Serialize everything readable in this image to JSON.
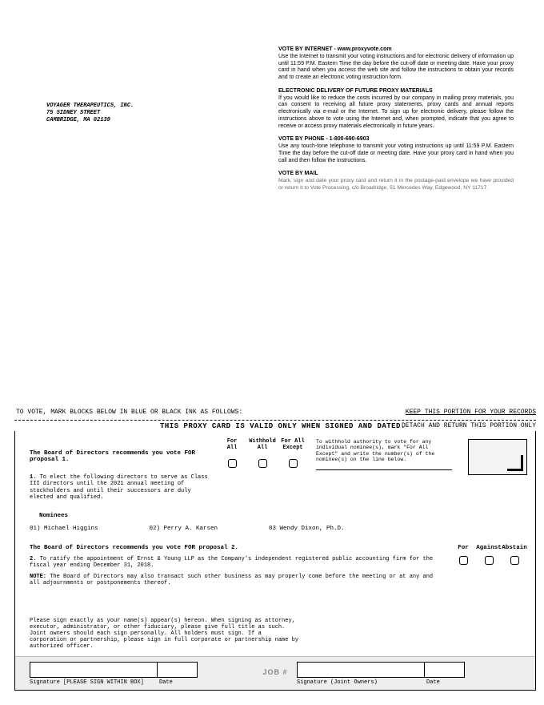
{
  "company": {
    "name": "VOYAGER THERAPEUTICS, INC.",
    "addr1": "75 SIDNEY STREET",
    "addr2": "CAMBRIDGE, MA 02139"
  },
  "vote_internet": {
    "title": "VOTE BY INTERNET - www.proxyvote.com",
    "body": "Use the Internet to transmit your voting instructions and for electronic delivery of information up until 11:59 P.M. Eastern Time the day before the cut-off date or meeting date. Have your proxy card in hand when you access the web site and follow the instructions to obtain your records and to create an electronic voting instruction form."
  },
  "elec_delivery": {
    "title": "ELECTRONIC DELIVERY OF FUTURE PROXY MATERIALS",
    "body": "If you would like to reduce the costs incurred by our company in mailing proxy materials, you can consent to receiving all future proxy statements, proxy cards and annual reports electronically via e-mail or the Internet. To sign up for electronic delivery, please follow the instructions above to vote using the Internet and, when prompted, indicate that you agree to receive or access proxy materials electronically in future years."
  },
  "vote_phone": {
    "title": "VOTE BY PHONE - 1-800-690-6903",
    "body": "Use any touch-tone telephone to transmit your voting instructions up until 11:59 P.M. Eastern Time the day before the cut-off date or meeting date. Have your proxy card in hand when you call and then follow the instructions."
  },
  "vote_mail": {
    "title": "VOTE BY MAIL",
    "body": "Mark, sign and date your proxy card and return it in the postage-paid envelope we have provided or return it to Vote Processing, c/o Broadridge, 51 Mercedes Way, Edgewood, NY 11717."
  },
  "mark_instr": "TO VOTE, MARK BLOCKS BELOW IN BLUE OR BLACK INK AS FOLLOWS:",
  "keep_portion": "KEEP THIS PORTION FOR YOUR RECORDS",
  "valid_line": "THIS PROXY CARD IS VALID ONLY WHEN SIGNED AND DATED.",
  "detach_return": "DETACH AND RETURN THIS PORTION ONLY",
  "rec1_a": "The Board of Directors recommends you vote FOR",
  "rec1_b": "proposal 1.",
  "hdr": {
    "for": "For\nAll",
    "withhold": "Withhold\nAll",
    "except": "For All\nExcept"
  },
  "withhold_note": "To withhold authority to vote for any individual nominee(s), mark \"For All Except\" and write the number(s) of the nominee(s) on the line below.",
  "p1_num": "1.",
  "p1_text": "To elect the following directors to serve as Class III directors until the 2021 annual meeting of stockholders and until their successors are duly elected and qualified.",
  "nominees_label": "Nominees",
  "nominees": {
    "n1": "01) Michael Higgins",
    "n2": "02) Perry A. Karsen",
    "n3": "03  Wendy Dixon, Ph.D."
  },
  "rec2": "The Board of Directors recommends you vote FOR proposal 2.",
  "hdr2": {
    "for": "For",
    "against": "Against",
    "abstain": "Abstain"
  },
  "p2_num": "2.",
  "p2_text": "To ratify the appointment of Ernst & Young LLP as the Company's independent registered public accounting firm for the fiscal year ending December 31, 2018.",
  "note_label": "NOTE:",
  "note_text": "The Board of Directors may also transact such other business as may properly come before the meeting or at any and all adjournments or postponements thereof.",
  "sign_instr": "Please sign exactly as your name(s) appear(s) hereon. When signing as attorney, executor, administrator, or other fiduciary, please give full title as such. Joint owners should each sign personally. All holders must sign. If a corporation or partnership, please sign in full corporate or partnership name by authorized officer.",
  "sig1_label": "Signature [PLEASE SIGN WITHIN BOX]",
  "sig1_date": "Date",
  "sig2_label": "Signature (Joint Owners)",
  "sig2_date": "Date",
  "job": "JOB #"
}
